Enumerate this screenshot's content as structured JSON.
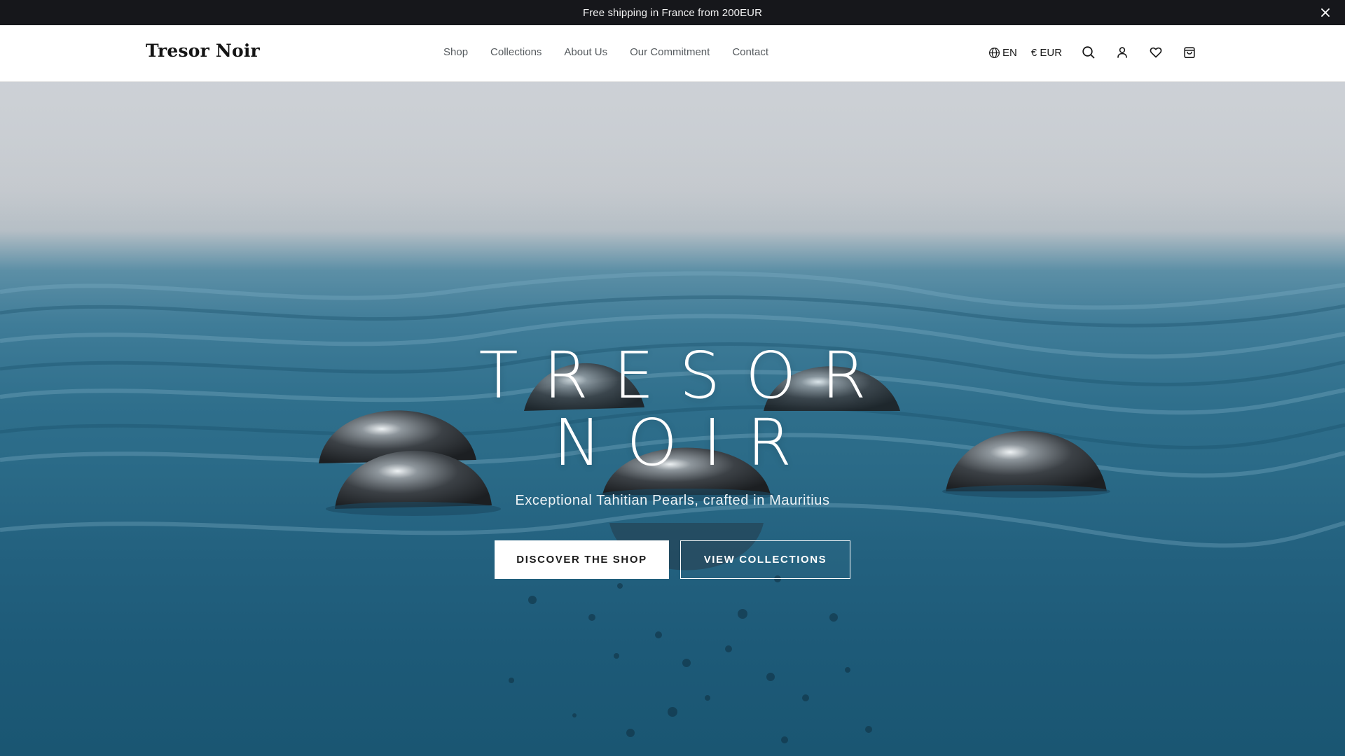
{
  "announcement": {
    "text": "Free shipping in France from 200EUR",
    "close_icon": "close-icon"
  },
  "header": {
    "logo": "Tresor Noir",
    "nav": [
      "Shop",
      "Collections",
      "About Us",
      "Our Commitment",
      "Contact"
    ],
    "language": "EN",
    "currency": "€ EUR",
    "icons": [
      "globe-icon",
      "search-icon",
      "user-icon",
      "heart-icon",
      "shopping-bag-icon"
    ]
  },
  "hero": {
    "title_line1": "TRESOR",
    "title_line2": "NOIR",
    "subtitle": "Exceptional Tahitian Pearls, crafted in Mauritius",
    "primary_button": "DISCOVER THE SHOP",
    "secondary_button": "VIEW COLLECTIONS"
  },
  "colors": {
    "announcement_bg": "#16171b",
    "header_bg": "#ffffff",
    "nav_text": "#555a5e",
    "water": "#2a6a87",
    "sky": "#c9cdd2"
  }
}
